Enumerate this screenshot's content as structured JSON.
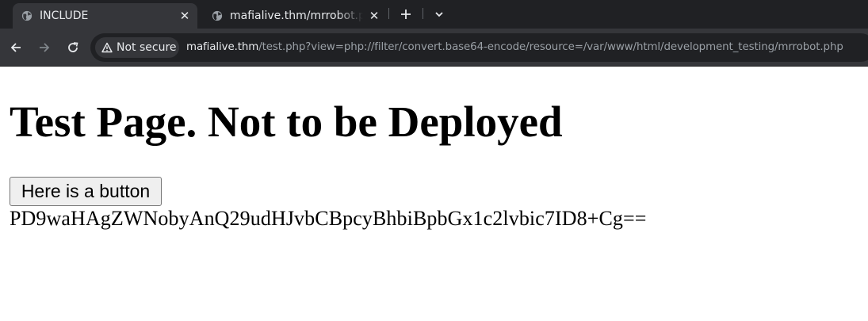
{
  "browser": {
    "tabs": [
      {
        "title": "INCLUDE",
        "active": true,
        "icon": "globe-icon"
      },
      {
        "title": "mafialive.thm/mrrobot.php",
        "active": false,
        "icon": "globe-icon"
      }
    ],
    "new_tab_icon": "plus-icon",
    "tab_search_icon": "chevron-down-icon",
    "nav": {
      "back_icon": "arrow-left-icon",
      "forward_icon": "arrow-right-icon",
      "reload_icon": "reload-icon"
    },
    "address": {
      "security_label": "Not secure",
      "security_icon": "warning-triangle-icon",
      "host": "mafialive.thm",
      "path": "/test.php?view=php://filter/convert.base64-encode/resource=/var/www/html/development_testing/mrrobot.php"
    },
    "colors": {
      "tabstrip": "#202124",
      "toolbar": "#35363a",
      "omnibox": "#202124",
      "url_host": "#e8eaed",
      "url_path": "#9aa0a6"
    }
  },
  "page": {
    "heading": "Test Page. Not to be Deployed",
    "button_label": "Here is a button",
    "output_text": "PD9waHAgZWNobyAnQ29udHJvbCBpcyBhbiBpbGx1c2lvbic7ID8+Cg=="
  }
}
